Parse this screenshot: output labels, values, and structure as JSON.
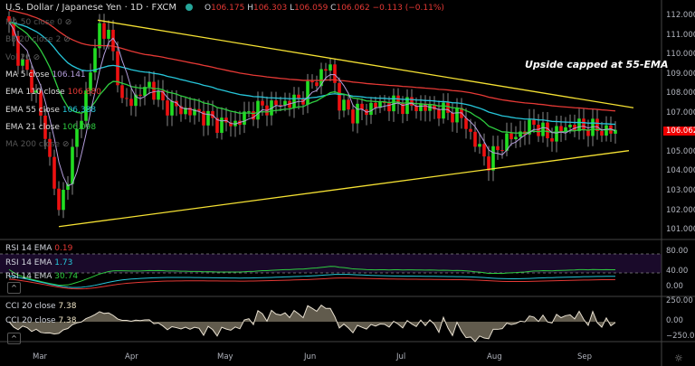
{
  "header": {
    "title": "U.S. Dollar / Japanese Yen · 1D · FXCM",
    "o_label": "O",
    "o": "106.175",
    "h_label": "H",
    "h": "106.303",
    "l_label": "L",
    "l": "106.059",
    "c_label": "C",
    "c": "106.062",
    "change": "−0.113 (−0.11%)"
  },
  "legend": [
    {
      "label": "MA 50 close 0",
      "value": "",
      "faded": true
    },
    {
      "label": "BB 20 close 2",
      "value": "",
      "faded": true
    },
    {
      "label": "Vol 20",
      "value": "",
      "faded": true
    },
    {
      "label": "MA 5 close",
      "value": "106.141",
      "color": "#b39ddb"
    },
    {
      "label": "EMA 110 close",
      "value": "106.880",
      "color": "#e53935"
    },
    {
      "label": "EMA 55 close",
      "value": "106.388",
      "color": "#26c6da"
    },
    {
      "label": "EMA 21 close",
      "value": "106.098",
      "color": "#2ecc40"
    },
    {
      "label": "MA 200 close",
      "value": "",
      "faded": true
    }
  ],
  "annotation": "Upside capped at 55-EMA",
  "price_axis": [
    "112.000",
    "111.000",
    "110.000",
    "109.000",
    "108.000",
    "107.000",
    "105.000",
    "104.000",
    "103.000",
    "102.000",
    "101.000"
  ],
  "last_price": "106.062",
  "rsi": {
    "legend": [
      {
        "label": "RSI 14 EMA",
        "value": "0.19"
      },
      {
        "label": "RSI 14 EMA",
        "value": "1.73"
      },
      {
        "label": "RSI 14 EMA",
        "value": "30.74"
      }
    ],
    "axis": [
      "80.00",
      "40.00",
      "0.00"
    ]
  },
  "cci": {
    "legend": [
      {
        "label": "CCI 20 close",
        "value": "7.38"
      },
      {
        "label": "CCI 20 close",
        "value": "7.38"
      }
    ],
    "axis": [
      "250.00",
      "0.00",
      "−250.00"
    ]
  },
  "months": [
    "Mar",
    "Apr",
    "May",
    "Jun",
    "Jul",
    "Aug",
    "Sep"
  ],
  "colors": {
    "up": "#22dd22",
    "down": "#ee1111",
    "trend": "#f5e133",
    "ema110": "#e53935",
    "ema55": "#26c6da",
    "ema21": "#2ecc40",
    "ma5": "#b39ddb"
  },
  "chart_data": {
    "type": "candlestick",
    "symbol": "USDJPY",
    "anchors": [
      [
        0,
        111.5
      ],
      [
        2,
        110
      ],
      [
        6,
        108
      ],
      [
        10,
        103.5
      ],
      [
        11,
        101.8
      ],
      [
        14,
        105
      ],
      [
        17,
        108
      ],
      [
        20,
        111.5
      ],
      [
        22,
        111
      ],
      [
        24,
        109
      ],
      [
        25,
        107.5
      ],
      [
        28,
        107.8
      ],
      [
        31,
        108.5
      ],
      [
        34,
        107.5
      ],
      [
        38,
        107.2
      ],
      [
        42,
        107
      ],
      [
        46,
        106.5
      ],
      [
        50,
        106.5
      ],
      [
        54,
        107.2
      ],
      [
        60,
        107.5
      ],
      [
        64,
        107.7
      ],
      [
        68,
        108.8
      ],
      [
        71,
        109.5
      ],
      [
        73,
        107.5
      ],
      [
        76,
        107
      ],
      [
        82,
        107.5
      ],
      [
        86,
        107.5
      ],
      [
        92,
        107.3
      ],
      [
        98,
        107
      ],
      [
        100,
        106.8
      ],
      [
        103,
        105.5
      ],
      [
        106,
        104.5
      ],
      [
        109,
        105.5
      ],
      [
        113,
        106
      ],
      [
        116,
        106.5
      ],
      [
        119,
        105.8
      ],
      [
        124,
        106.4
      ],
      [
        134,
        106.06
      ]
    ],
    "trendlines": [
      {
        "from": [
          19.6,
          111.8
        ],
        "to": [
          138,
          107.3
        ]
      },
      {
        "from": [
          11,
          101.2
        ],
        "to": [
          137,
          105.1
        ]
      }
    ],
    "month_index": [
      6.6,
      27,
      47.4,
      66.6,
      87,
      107,
      127
    ],
    "ylim": [
      100.5,
      112.5
    ]
  }
}
